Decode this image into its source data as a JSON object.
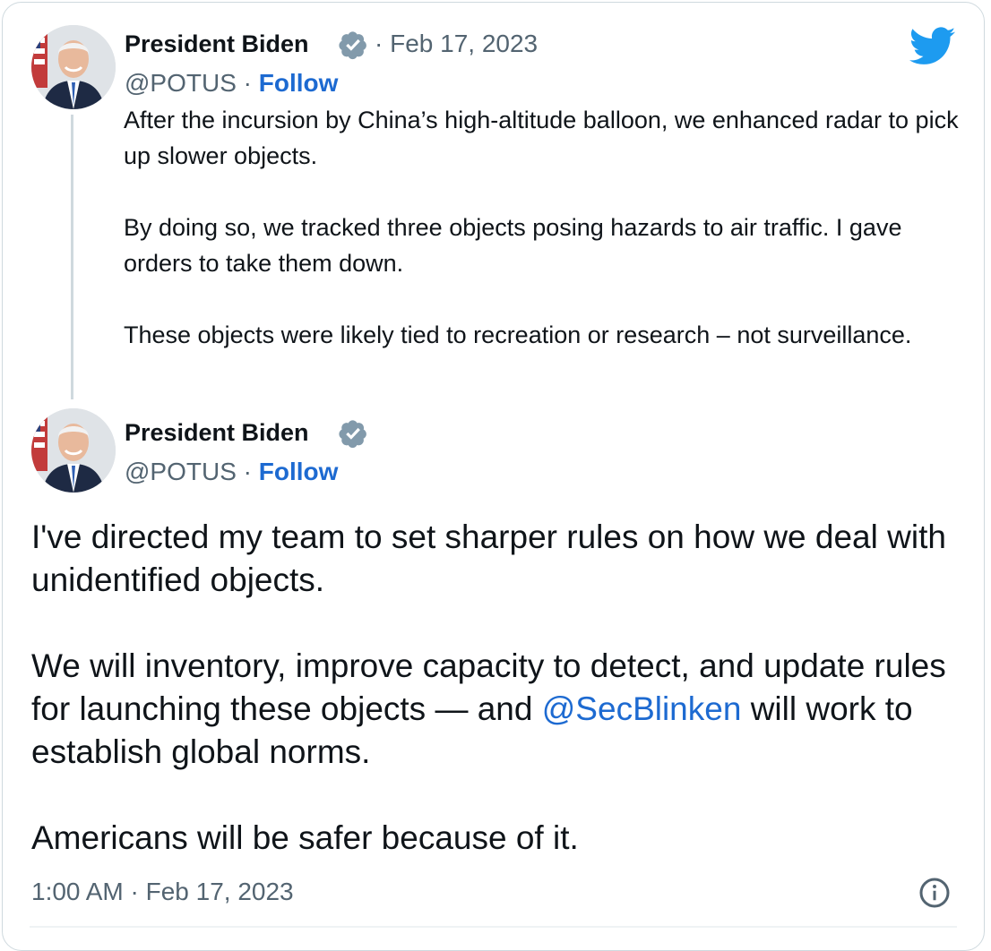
{
  "quoted_tweet": {
    "author_name": "President Biden",
    "handle": "@POTUS",
    "separator": "·",
    "follow_label": "Follow",
    "date": "Feb 17, 2023",
    "paragraphs": [
      "After the incursion by China’s high-altitude balloon, we enhanced radar to pick up slower objects.",
      "By doing so, we tracked three objects posing hazards to air traffic. I gave orders to take them down.",
      "These objects were likely tied to recreation or research – not surveillance."
    ]
  },
  "main_tweet": {
    "author_name": "President Biden",
    "handle": "@POTUS",
    "separator": "·",
    "follow_label": "Follow",
    "paragraph_1": "I've directed my team to set sharper rules on how we deal with unidentified objects.",
    "paragraph_2_before": "We will inventory, improve capacity to detect, and update rules for launching these objects — and ",
    "paragraph_2_mention": "@SecBlinken",
    "paragraph_2_after": " will work to establish global norms.",
    "paragraph_3": "Americans will be safer because of it.",
    "timestamp": "1:00 AM · Feb 17, 2023"
  },
  "icons": {
    "brand": "twitter-bird-icon",
    "verified": "verified-badge-icon",
    "info": "info-icon"
  },
  "colors": {
    "link": "#1d6ad1",
    "brand_blue": "#1d9bf0",
    "secondary_text": "#536471",
    "verified_gray": "#829aab",
    "border": "#cfd9de"
  }
}
